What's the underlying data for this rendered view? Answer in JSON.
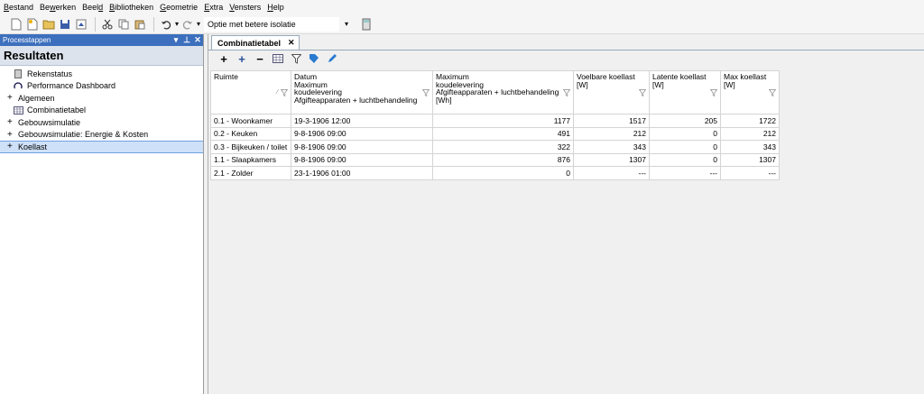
{
  "menubar": {
    "items": [
      {
        "pre": "",
        "u": "B",
        "post": "estand"
      },
      {
        "pre": "Be",
        "u": "w",
        "post": "erken"
      },
      {
        "pre": "Beel",
        "u": "d",
        "post": ""
      },
      {
        "pre": "",
        "u": "B",
        "post": "ibliotheken"
      },
      {
        "pre": "",
        "u": "G",
        "post": "eometrie"
      },
      {
        "pre": "",
        "u": "E",
        "post": "xtra"
      },
      {
        "pre": "",
        "u": "V",
        "post": "ensters"
      },
      {
        "pre": "",
        "u": "H",
        "post": "elp"
      }
    ]
  },
  "toolbar": {
    "variant_select": "Optie met betere isolatie"
  },
  "left_panel": {
    "header": "Processtappen",
    "section_title": "Resultaten",
    "items": [
      {
        "label": "Rekenstatus",
        "expander": "",
        "icon": "calculator-icon"
      },
      {
        "label": "Performance Dashboard",
        "expander": "",
        "icon": "gauge-icon"
      },
      {
        "label": "Algemeen",
        "expander": "+",
        "icon": ""
      },
      {
        "label": "Combinatietabel",
        "expander": "",
        "icon": "table-icon"
      },
      {
        "label": "Gebouwsimulatie",
        "expander": "+",
        "icon": ""
      },
      {
        "label": "Gebouwsimulatie: Energie & Kosten",
        "expander": "+",
        "icon": ""
      },
      {
        "label": "Koellast",
        "expander": "+",
        "icon": ""
      }
    ]
  },
  "main": {
    "tab_label": "Combinatietabel",
    "columns": [
      {
        "lines": [
          "Ruimte"
        ]
      },
      {
        "lines": [
          "Datum",
          "Maximum",
          "koudelevering",
          "Afgifteapparaten + luchtbehandeling"
        ]
      },
      {
        "lines": [
          "Maximum",
          "koudelevering",
          "Afgifteapparaten + luchtbehandeling",
          "[Wh]"
        ]
      },
      {
        "lines": [
          "Voelbare koellast",
          "[W]"
        ]
      },
      {
        "lines": [
          "Latente koellast",
          "[W]"
        ]
      },
      {
        "lines": [
          "Max koellast",
          "[W]"
        ]
      }
    ],
    "rows": [
      [
        "0.1 - Woonkamer",
        "19-3-1906 12:00",
        "1177",
        "1517",
        "205",
        "1722"
      ],
      [
        "0.2 - Keuken",
        "9-8-1906 09:00",
        "491",
        "212",
        "0",
        "212"
      ],
      [
        "0.3 - Bijkeuken / toilet",
        "9-8-1906 09:00",
        "322",
        "343",
        "0",
        "343"
      ],
      [
        "1.1 - Slaapkamers",
        "9-8-1906 09:00",
        "876",
        "1307",
        "0",
        "1307"
      ],
      [
        "2.1 - Zolder",
        "23-1-1906 01:00",
        "0",
        "---",
        "---",
        "---"
      ]
    ]
  },
  "colors": {
    "panel_header": "#3c6fbd",
    "selection": "#cfe1f8",
    "section_bg": "#dde3ec"
  }
}
